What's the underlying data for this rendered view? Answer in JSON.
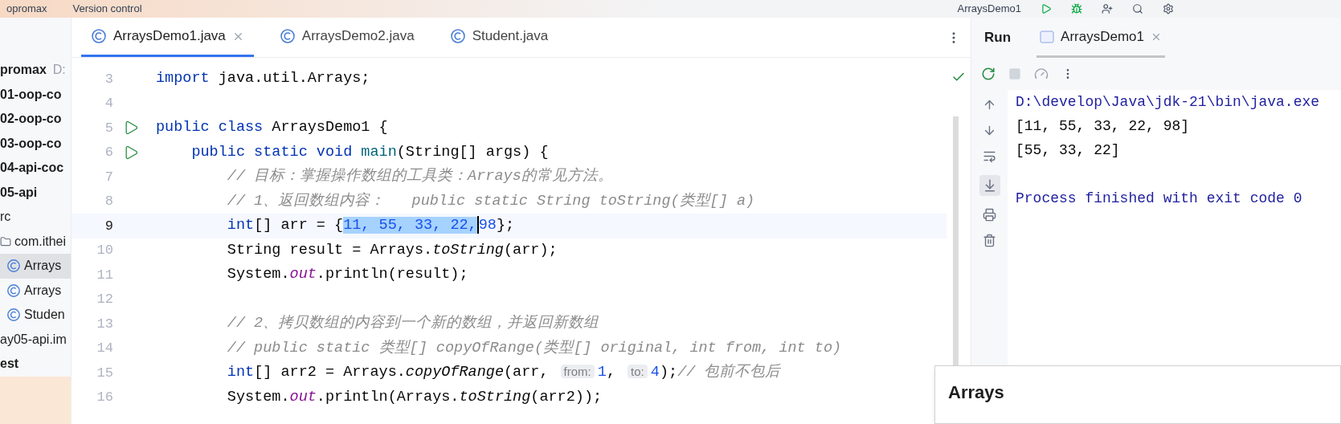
{
  "top_bar": {
    "project": "opromax",
    "vcs": "Version control",
    "run_config": "ArraysDemo1"
  },
  "project_tree": [
    {
      "label": "promax",
      "hint": "D:",
      "kind": "module",
      "selected": false
    },
    {
      "label": "01-oop-co",
      "kind": "module",
      "selected": false
    },
    {
      "label": "02-oop-co",
      "kind": "module",
      "selected": false
    },
    {
      "label": "03-oop-co",
      "kind": "module",
      "selected": false
    },
    {
      "label": "04-api-coc",
      "kind": "module",
      "selected": false
    },
    {
      "label": "05-api",
      "kind": "module",
      "selected": false
    },
    {
      "label": "rc",
      "kind": "file",
      "selected": false
    },
    {
      "label": "com.ithei",
      "kind": "package",
      "selected": false
    },
    {
      "label": "Arrays",
      "kind": "class",
      "selected": true
    },
    {
      "label": "Arrays",
      "kind": "class",
      "selected": false
    },
    {
      "label": "Studen",
      "kind": "class",
      "selected": false
    },
    {
      "label": "ay05-api.im",
      "kind": "file",
      "selected": false
    },
    {
      "label": "est",
      "kind": "module",
      "selected": false
    }
  ],
  "editor_tabs": [
    {
      "label": "ArraysDemo1.java",
      "selected": true,
      "closable": true
    },
    {
      "label": "ArraysDemo2.java",
      "selected": false,
      "closable": false
    },
    {
      "label": "Student.java",
      "selected": false,
      "closable": false
    }
  ],
  "code_lines": [
    {
      "number": "3",
      "run": false,
      "current": false,
      "segments": [
        {
          "kind": "kw",
          "text": "import "
        },
        {
          "kind": "text",
          "text": "java.util.Arrays;"
        }
      ]
    },
    {
      "number": "4",
      "run": false,
      "current": false
    },
    {
      "number": "5",
      "run": true,
      "current": false,
      "segments": [
        {
          "kind": "kw",
          "text": "public class "
        },
        {
          "kind": "text",
          "text": "ArraysDemo1 {"
        }
      ]
    },
    {
      "number": "6",
      "run": true,
      "current": false,
      "segments": [
        {
          "kind": "kw",
          "text": "    public static void "
        },
        {
          "kind": "method",
          "text": "main"
        },
        {
          "kind": "text",
          "text": "(String[] args) {"
        }
      ]
    },
    {
      "number": "7",
      "run": false,
      "current": false,
      "segments": [
        {
          "kind": "comment",
          "text": "        // 目标：掌握操作数组的工具类：Arrays的常见方法。"
        }
      ]
    },
    {
      "number": "8",
      "run": false,
      "current": false,
      "segments": [
        {
          "kind": "comment",
          "text": "        // 1、返回数组内容：   public static String toString(类型[] a)"
        }
      ]
    },
    {
      "number": "9",
      "run": false,
      "current": true,
      "segments": [
        {
          "kind": "kw",
          "text": "        int"
        },
        {
          "kind": "text",
          "text": "[] arr = {"
        },
        {
          "kind": "sel",
          "text": "11, 55, 33, 22,",
          "caret": true
        },
        {
          "kind": "num",
          "text": "98"
        },
        {
          "kind": "text",
          "text": "};"
        }
      ]
    },
    {
      "number": "10",
      "run": false,
      "current": false,
      "segments": [
        {
          "kind": "text",
          "text": "        String result = Arrays."
        },
        {
          "kind": "static",
          "text": "toString"
        },
        {
          "kind": "text",
          "text": "(arr);"
        }
      ]
    },
    {
      "number": "11",
      "run": false,
      "current": false,
      "segments": [
        {
          "kind": "text",
          "text": "        System."
        },
        {
          "kind": "field",
          "text": "out"
        },
        {
          "kind": "text",
          "text": ".println(result);"
        }
      ]
    },
    {
      "number": "12",
      "run": false,
      "current": false
    },
    {
      "number": "13",
      "run": false,
      "current": false,
      "segments": [
        {
          "kind": "comment",
          "text": "        // 2、拷贝数组的内容到一个新的数组，并返回新数组"
        }
      ]
    },
    {
      "number": "14",
      "run": false,
      "current": false,
      "segments": [
        {
          "kind": "comment",
          "text": "        // public static 类型[] copyOfRange(类型[] original, int from, int to)"
        }
      ]
    },
    {
      "number": "15",
      "run": false,
      "current": false,
      "segments": [
        {
          "kind": "kw",
          "text": "        int"
        },
        {
          "kind": "text",
          "text": "[] arr2 = Arrays."
        },
        {
          "kind": "static",
          "text": "copyOfRange"
        },
        {
          "kind": "text",
          "text": "(arr, "
        },
        {
          "kind": "hint",
          "text": "from:"
        },
        {
          "kind": "num",
          "text": "1"
        },
        {
          "kind": "text",
          "text": ", "
        },
        {
          "kind": "hint",
          "text": "to:"
        },
        {
          "kind": "num",
          "text": "4"
        },
        {
          "kind": "text",
          "text": ");"
        },
        {
          "kind": "comment",
          "text": "// 包前不包后"
        }
      ]
    },
    {
      "number": "16",
      "run": false,
      "current": false,
      "segments": [
        {
          "kind": "text",
          "text": "        System."
        },
        {
          "kind": "field",
          "text": "out"
        },
        {
          "kind": "text",
          "text": ".println(Arrays."
        },
        {
          "kind": "static",
          "text": "toString"
        },
        {
          "kind": "text",
          "text": "(arr2));"
        }
      ]
    }
  ],
  "run_panel": {
    "title": "Run",
    "tab": "ArraysDemo1",
    "output": [
      {
        "kind": "command",
        "text": "D:\\develop\\Java\\jdk-21\\bin\\java.exe"
      },
      {
        "kind": "stdout",
        "text": "[11, 55, 33, 22, 98]"
      },
      {
        "kind": "stdout",
        "text": "[55, 33, 22]"
      },
      {
        "kind": "exit",
        "text": "Process finished with exit code 0"
      }
    ]
  },
  "doc_popup": {
    "title": "Arrays"
  }
}
